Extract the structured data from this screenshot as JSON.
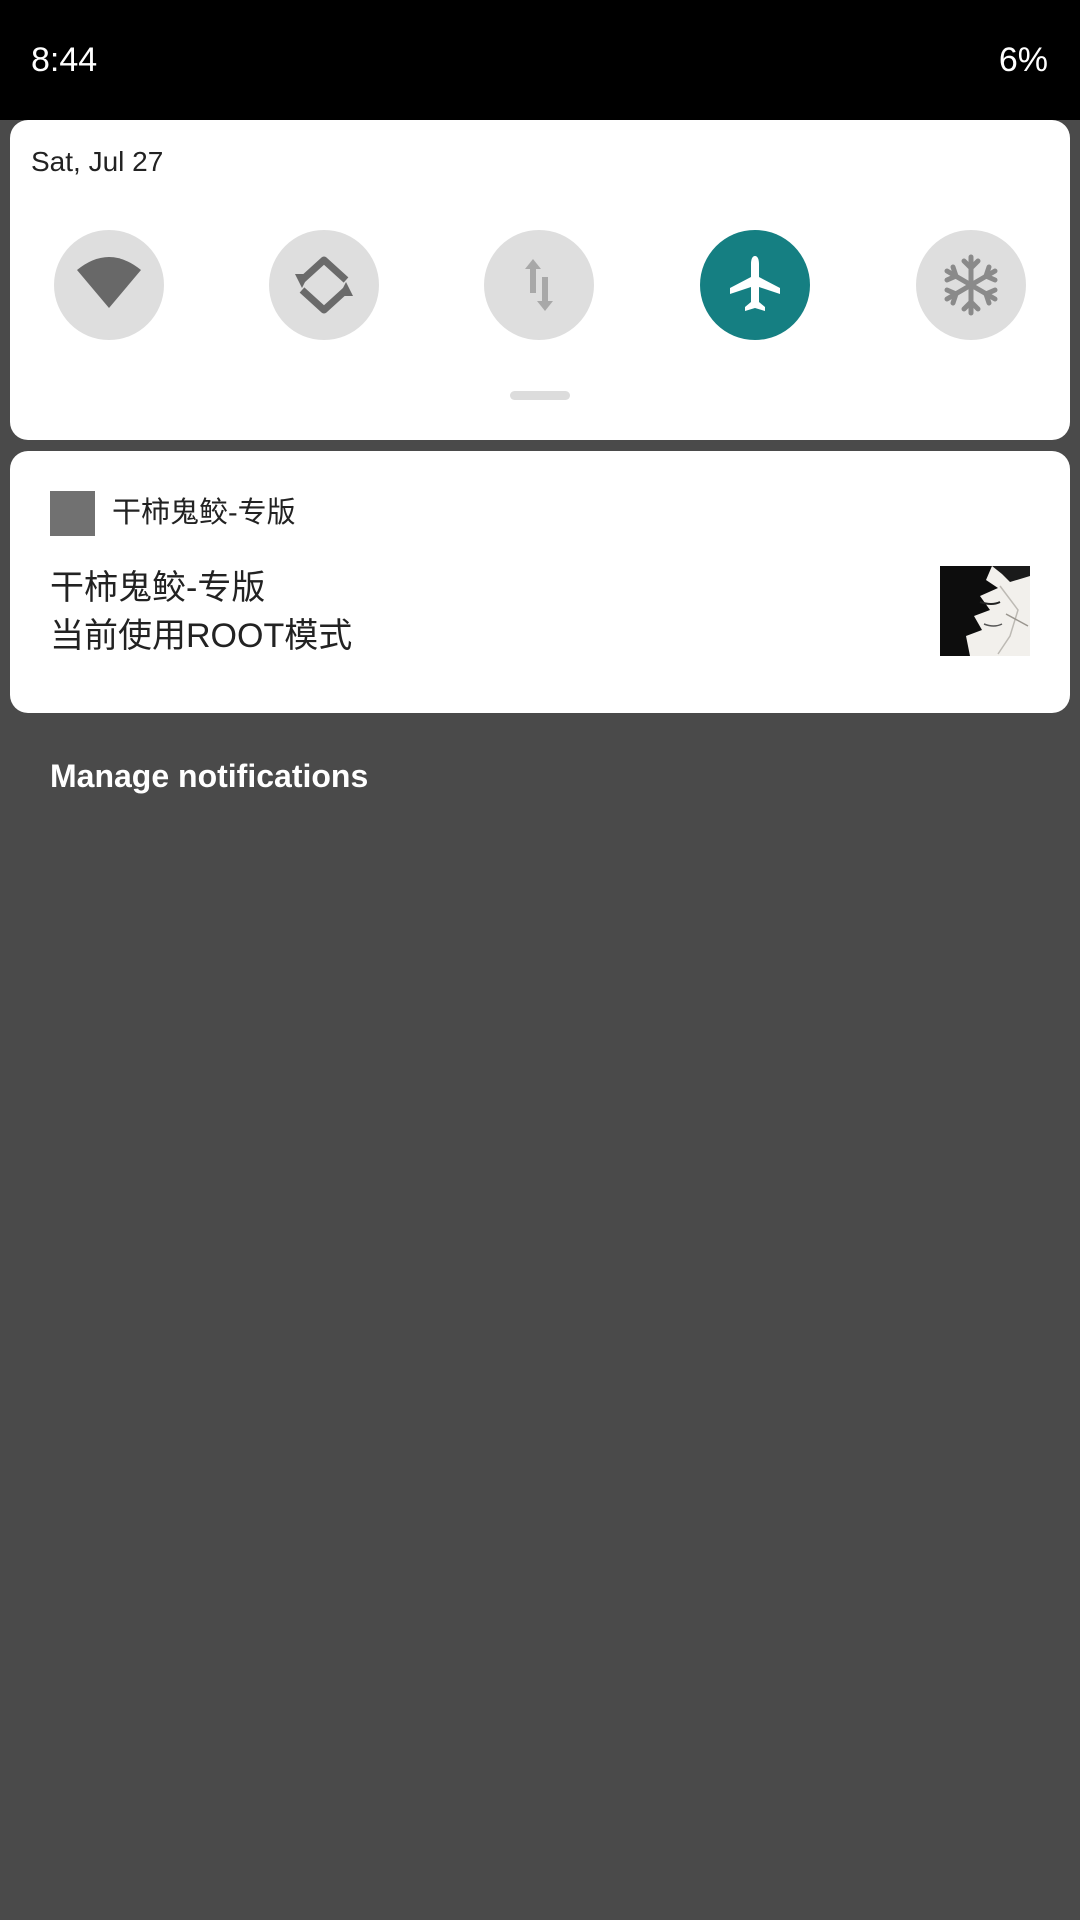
{
  "status_bar": {
    "time": "8:44",
    "battery": "6%"
  },
  "quick_settings": {
    "date": "Sat, Jul 27",
    "tiles": [
      {
        "icon": "wifi-icon",
        "active": false
      },
      {
        "icon": "auto-rotate-icon",
        "active": false
      },
      {
        "icon": "mobile-data-icon",
        "active": false
      },
      {
        "icon": "airplane-icon",
        "active": true
      },
      {
        "icon": "snowflake-icon",
        "active": false
      }
    ],
    "accent_color": "#157f82"
  },
  "notification": {
    "app_name": "干柿鬼鲛-专版",
    "title": "干柿鬼鲛-专版",
    "text": "当前使用ROOT模式"
  },
  "footer": {
    "manage_label": "Manage notifications"
  }
}
